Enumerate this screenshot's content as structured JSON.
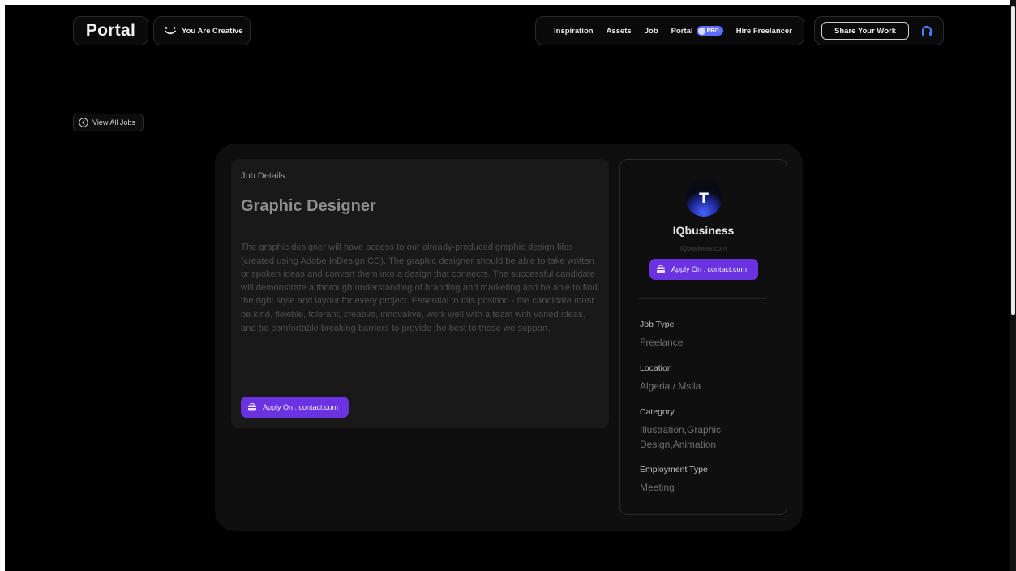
{
  "header": {
    "logo_text": "Portal",
    "creative_label": "You Are Creative",
    "nav": [
      {
        "label": "Inspiration"
      },
      {
        "label": "Assets"
      },
      {
        "label": "Job"
      },
      {
        "label": "Portal",
        "badge": "PRO"
      },
      {
        "label": "Hire Freelancer"
      }
    ],
    "share_label": "Share Your Work"
  },
  "back_label": "View All Jobs",
  "job": {
    "section_label": "Job Details",
    "title": "Graphic Designer",
    "description": "The graphic designer will have access to our already-produced graphic design files (created using Adobe InDesign CC). The graphic designer should be able to take written or spoken ideas and convert them into a design that connects. The successful candidate will demonstrate a thorough understanding of branding and marketing and be able to find the right style and layout for every project. Essential to this position - the candidate must be kind, flexible, tolerant, creative, innovative, work well with a team with varied ideas, and be comfortable breaking barriers to provide the best to those we support.",
    "apply_label": "Apply On : contact.com"
  },
  "company": {
    "logo_letter": "T",
    "name": "IQbusiness",
    "site": "IQbusiness.com",
    "apply_label": "Apply On : contact.com"
  },
  "meta": {
    "job_type_label": "Job Type",
    "job_type": "Freelance",
    "location_label": "Location",
    "location": "Algeria / Msila",
    "category_label": "Category",
    "category": "Illustration,Graphic Design,Animation",
    "employment_label": "Employment Type",
    "employment": "Meeting"
  },
  "colors": {
    "accent": "#6a32e0",
    "pro_badge": "#5b6cff",
    "headset": "#4a7cff"
  }
}
